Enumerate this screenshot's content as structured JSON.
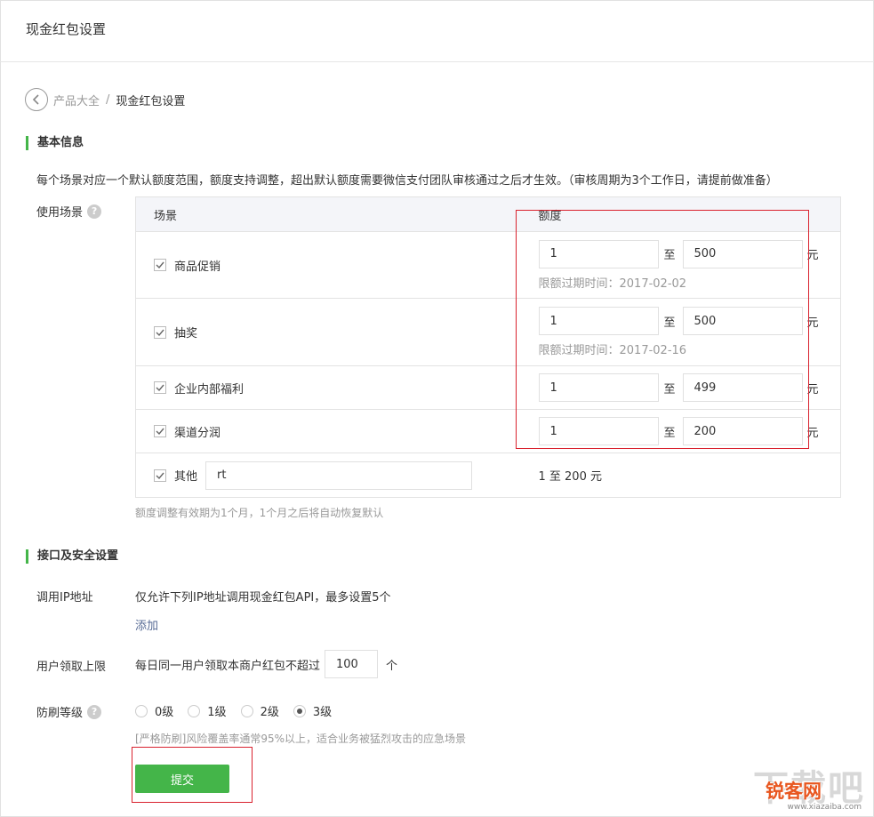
{
  "header": {
    "title": "现金红包设置"
  },
  "breadcrumb": {
    "parent": "产品大全",
    "separator": "/",
    "current": "现金红包设置"
  },
  "basic": {
    "title": "基本信息",
    "note": "每个场景对应一个默认额度范围，额度支持调整，超出默认额度需要微信支付团队审核通过之后才生效。（审核周期为3个工作日，请提前做准备）",
    "scene_label": "使用场景",
    "help_glyph": "?",
    "columns": {
      "scene": "场景",
      "amount": "额度"
    },
    "to_text": "至",
    "unit": "元",
    "rows": [
      {
        "name": "商品促销",
        "min": "1",
        "max": "500",
        "expire": "限额过期时间：2017-02-02"
      },
      {
        "name": "抽奖",
        "min": "1",
        "max": "500",
        "expire": "限额过期时间：2017-02-16"
      },
      {
        "name": "企业内部福利",
        "min": "1",
        "max": "499"
      },
      {
        "name": "渠道分润",
        "min": "1",
        "max": "200"
      }
    ],
    "other": {
      "name": "其他",
      "value": "rt",
      "amount_text": "1 至 200 元"
    },
    "hint": "额度调整有效期为1个月，1个月之后将自动恢复默认"
  },
  "security": {
    "title": "接口及安全设置",
    "ip_label": "调用IP地址",
    "ip_desc": "仅允许下列IP地址调用现金红包API，最多设置5个",
    "add_link": "添加",
    "limit_label": "用户领取上限",
    "limit_prefix": "每日同一用户领取本商户红包不超过",
    "limit_value": "100",
    "limit_suffix": "个",
    "level_label": "防刷等级",
    "levels": [
      "0级",
      "1级",
      "2级",
      "3级"
    ],
    "selected_level": "3级",
    "level_hint": "[严格防刷]风险覆盖率通常95%以上，适合业务被猛烈攻击的应急场景",
    "submit": "提交"
  },
  "watermark": {
    "brand": "锐客网",
    "big": "下载吧",
    "site": "www.xiazaiba.com"
  },
  "colors": {
    "accent": "#44b549",
    "link": "#576b95",
    "highlight": "#d9222e"
  }
}
